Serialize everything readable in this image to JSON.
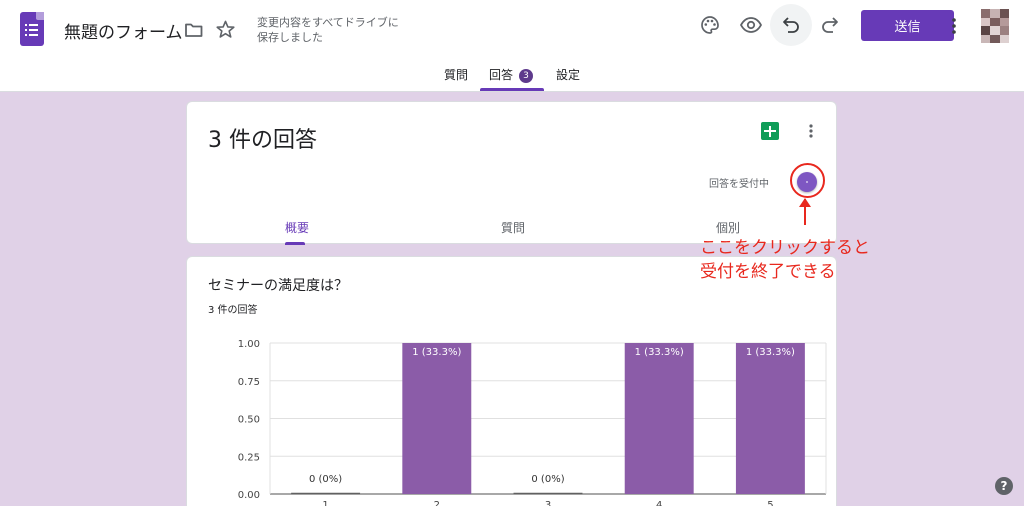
{
  "header": {
    "title": "無題のフォーム",
    "save_status": "変更内容をすべてドライブに保存しました",
    "send_label": "送信",
    "icons": [
      "folder-icon",
      "star-icon",
      "palette-icon",
      "eye-icon",
      "undo-icon",
      "redo-icon",
      "more-vert-icon"
    ]
  },
  "tabs": {
    "questions": "質問",
    "responses": "回答",
    "responses_count": "3",
    "settings": "設定"
  },
  "summary": {
    "count_title": "3 件の回答",
    "accepting_label": "回答を受付中",
    "subtabs": {
      "summary": "概要",
      "question": "質問",
      "individual": "個別"
    }
  },
  "annotation": {
    "arrow": "↑",
    "line1": "ここをクリックすると",
    "line2": "受付を終了できる"
  },
  "question": {
    "title": "セミナーの満足度は？",
    "response_count": "3 件の回答"
  },
  "colors": {
    "accent": "#673ab7",
    "bar": "#8b5ca8",
    "page_bg": "#e0d1e7",
    "annotation": "#e8281e"
  },
  "chart_data": {
    "type": "bar",
    "categories": [
      "1",
      "2",
      "3",
      "4",
      "5"
    ],
    "values": [
      0,
      1,
      0,
      1,
      1
    ],
    "data_labels": [
      "0 (0%)",
      "1 (33.3%)",
      "0 (0%)",
      "1 (33.3%)",
      "1 (33.3%)"
    ],
    "ylim": [
      0,
      1
    ],
    "yticks": [
      "0.00",
      "0.25",
      "0.50",
      "0.75",
      "1.00"
    ],
    "grid": true
  }
}
